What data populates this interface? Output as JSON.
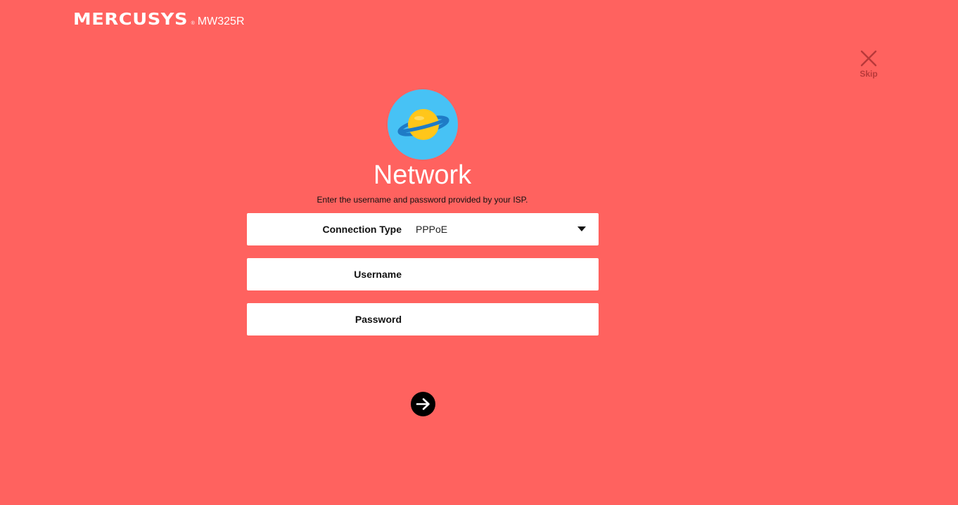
{
  "header": {
    "brand": "MERCUSYS",
    "trademark": "®",
    "model": "MW325R"
  },
  "skip": {
    "label": "Skip",
    "icon": "close-icon"
  },
  "hero": {
    "icon": "planet-icon",
    "title": "Network",
    "subtitle": "Enter the username and password provided by your ISP."
  },
  "form": {
    "connection_type": {
      "label": "Connection Type",
      "value": "PPPoE",
      "icon": "chevron-down-icon"
    },
    "username": {
      "label": "Username",
      "value": ""
    },
    "password": {
      "label": "Password",
      "value": ""
    }
  },
  "actions": {
    "next_icon": "arrow-right-icon"
  },
  "colors": {
    "background": "#FF625F",
    "icon_circle": "#47C2F5",
    "planet": "#FFC61A",
    "ring": "#1F7BC6",
    "skip": "#B8393A"
  }
}
